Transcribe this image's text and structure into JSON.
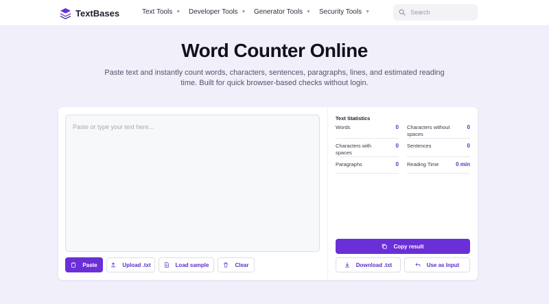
{
  "brand": {
    "name": "TextBases",
    "color": "#6a2fd6"
  },
  "nav": [
    {
      "label": "Text Tools"
    },
    {
      "label": "Developer Tools"
    },
    {
      "label": "Generator Tools"
    },
    {
      "label": "Security Tools"
    }
  ],
  "search": {
    "placeholder": "Search"
  },
  "hero": {
    "title": "Word Counter Online",
    "description": "Paste text and instantly count words, characters, sentences, paragraphs, lines, and estimated reading time. Built for quick browser-based checks without login."
  },
  "editor": {
    "placeholder": "Paste or type your text here..."
  },
  "actions": {
    "paste": "Paste",
    "upload": "Upload .txt",
    "load_sample": "Load sample",
    "clear": "Clear"
  },
  "stats": {
    "title": "Text Statistics",
    "items": [
      {
        "label": "Words",
        "value": "0"
      },
      {
        "label": "Characters without spaces",
        "value": "0"
      },
      {
        "label": "Characters with spaces",
        "value": "0"
      },
      {
        "label": "Sentences",
        "value": "0"
      },
      {
        "label": "Paragraphs",
        "value": "0"
      },
      {
        "label": "Reading Time",
        "value": "0 min"
      }
    ]
  },
  "result_actions": {
    "copy": "Copy result",
    "download": "Download .txt",
    "use_as_input": "Use as Input"
  }
}
